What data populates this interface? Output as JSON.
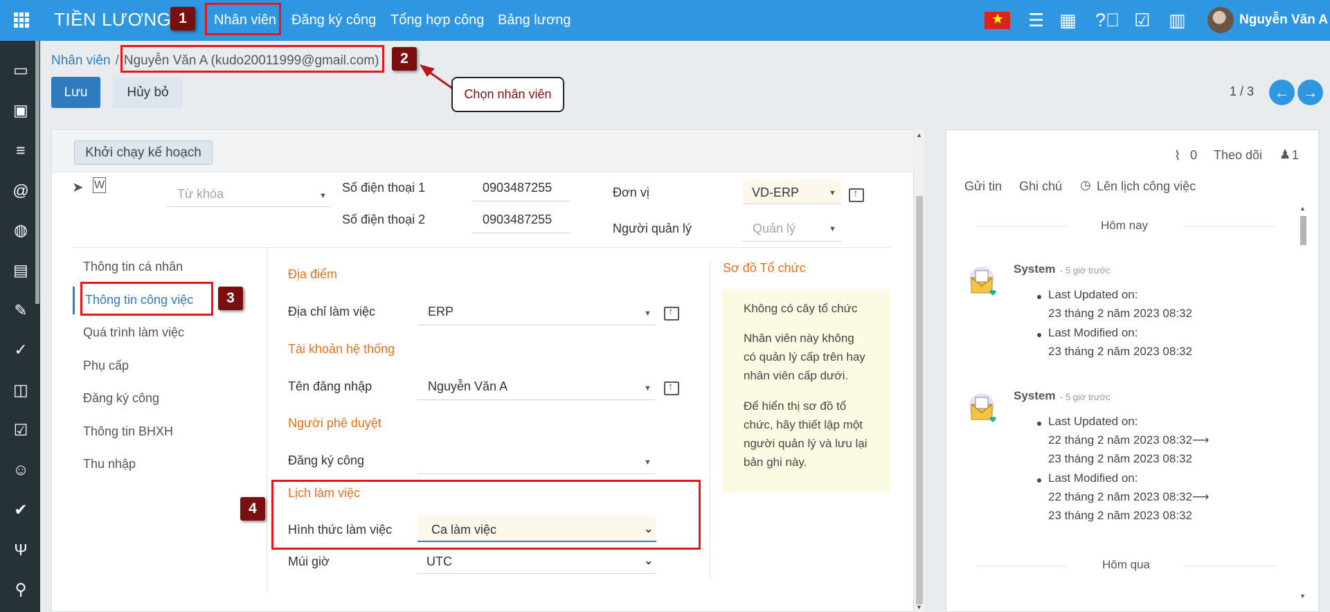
{
  "topbar": {
    "app_title": "TIỀN LƯƠNG",
    "menu": [
      "Nhân viên",
      "Đăng ký công",
      "Tổng hợp công",
      "Bảng lương"
    ],
    "user_name": "Nguyễn Văn A",
    "icons": [
      "apps-grid-icon",
      "vietnam-flag-icon",
      "activity-list-icon",
      "calendar-icon",
      "help-icon",
      "clipboard-check-icon",
      "building-icon"
    ]
  },
  "sidebar": {
    "icons": [
      "chat-icon",
      "calendar-icon",
      "notes-icon",
      "at-icon",
      "globe-icon",
      "document-icon",
      "signature-icon",
      "check-circle-icon",
      "clipboard-time-icon",
      "checklist-icon",
      "smiley-icon",
      "double-check-icon",
      "fork-knife-icon",
      "user-search-icon"
    ]
  },
  "breadcrumb": {
    "parent": "Nhân viên",
    "separator": "/",
    "current": "Nguyễn Văn A (kudo20011999@gmail.com)"
  },
  "actions": {
    "save": "Lưu",
    "discard": "Hủy bỏ"
  },
  "pager": {
    "text": "1 / 3",
    "prev": "←",
    "next": "→"
  },
  "callouts": {
    "n1": "1",
    "n2": "2",
    "n3": "3",
    "n4": "4",
    "tooltip": "Chọn nhân viên"
  },
  "form": {
    "run_plan_button": "Khởi chạy kế hoạch",
    "keyword_placeholder": "Từ khóa",
    "phone1_label": "Số điện thoại 1",
    "phone1_value": "0903487255",
    "phone2_label": "Số điện thoại 2",
    "phone2_value": "0903487255",
    "unit_label": "Đơn vị",
    "unit_value": "VD-ERP",
    "manager_label": "Người quản lý",
    "manager_placeholder": "Quản lý",
    "tabs": [
      "Thông tin cá nhân",
      "Thông tin công việc",
      "Quá trình làm việc",
      "Phụ cấp",
      "Đăng ký công",
      "Thông tin BHXH",
      "Thu nhập"
    ],
    "sections": {
      "location": {
        "title": "Địa điểm",
        "work_address_label": "Địa chỉ làm việc",
        "work_address_value": "ERP"
      },
      "account": {
        "title": "Tài khoản hệ thống",
        "username_label": "Tên đăng nhập",
        "username_value": "Nguyễn Văn A"
      },
      "approver": {
        "title": "Người phê duyệt",
        "attendance_label": "Đăng ký công",
        "attendance_value": ""
      },
      "schedule": {
        "title": "Lịch làm việc",
        "work_mode_label": "Hình thức làm việc",
        "work_mode_value": "Ca làm việc",
        "timezone_label": "Múi giờ",
        "timezone_value": "UTC"
      }
    },
    "org_chart": {
      "title": "Sơ đồ Tổ chức",
      "line1": "Không có cây tổ chức",
      "p2": [
        "Nhân viên này không",
        "có quản lý cấp trên hay",
        "nhân viên cấp dưới."
      ],
      "p3": [
        "Để hiển thị sơ đồ tổ",
        "chức, hãy thiết lập một",
        "người quản lý và lưu lại",
        "bản ghi này."
      ]
    }
  },
  "chatter": {
    "attachments_count": "0",
    "follow_label": "Theo dõi",
    "followers_count": "1",
    "send_message": "Gửi tin",
    "log_note": "Ghi chú",
    "schedule_activity": "Lên lịch công việc",
    "today": "Hôm nay",
    "yesterday": "Hôm qua",
    "messages": [
      {
        "author": "System",
        "time": "- 5 giờ trước",
        "updated_label": "Last Updated on:",
        "updated_value": "23 tháng 2 năm 2023 08:32",
        "modified_label": "Last Modified on:",
        "modified_value": "23 tháng 2 năm 2023 08:32"
      },
      {
        "author": "System",
        "time": "- 5 giờ trước",
        "updated_label": "Last Updated on:",
        "updated_old": "22 tháng 2 năm 2023 08:32",
        "updated_new": "23 tháng 2 năm 2023 08:32",
        "modified_label": "Last Modified on:",
        "modified_old": "22 tháng 2 năm 2023 08:32",
        "modified_new": "23 tháng 2 năm 2023 08:32",
        "arrow": "⟶"
      }
    ]
  },
  "colors": {
    "topbar": "#2f97e2",
    "sidebar": "#263238",
    "primary": "#2f7bbf",
    "section_orange": "#e8701f",
    "annotation_red": "#e8151b",
    "callout_badge": "#7a0f0f"
  }
}
